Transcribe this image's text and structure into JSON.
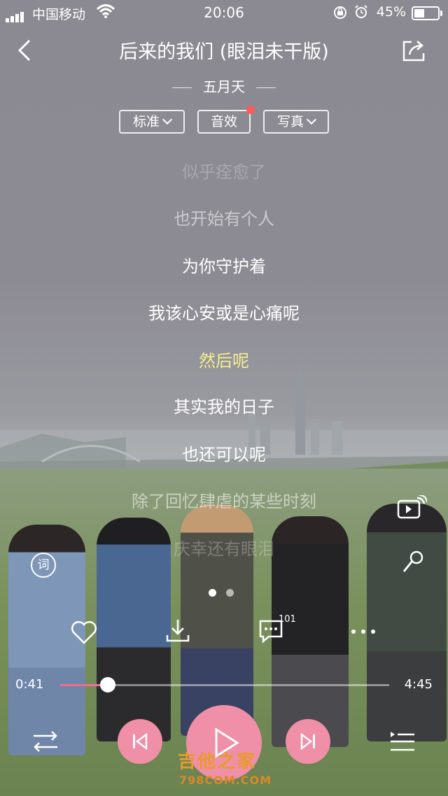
{
  "status_bar": {
    "carrier": "中国移动",
    "time": "20:06",
    "battery_percent": "45%"
  },
  "header": {
    "title": "后来的我们 (眼泪未干版)",
    "artist": "五月天"
  },
  "chips": {
    "standard": "标准",
    "effects": "音效",
    "photo": "写真"
  },
  "lyrics": [
    "似乎痊愈了",
    "也开始有个人",
    "为你守护着",
    "我该心安或是心痛呢",
    "然后呢",
    "其实我的日子",
    "也还可以呢",
    "除了回忆肆虐的某些时刻",
    "庆幸还有眼泪"
  ],
  "lyric_icon_label": "词",
  "comment_count": "101",
  "progress": {
    "current": "0:41",
    "total": "4:45",
    "fraction": 0.144
  },
  "watermark": {
    "main": "吉他之家",
    "sub": "798COM.COM"
  },
  "colors": {
    "accent": "#f08fa8",
    "current_lyric": "#f7ef8c",
    "played": "#f06c93",
    "badge": "#ff5a5a"
  }
}
